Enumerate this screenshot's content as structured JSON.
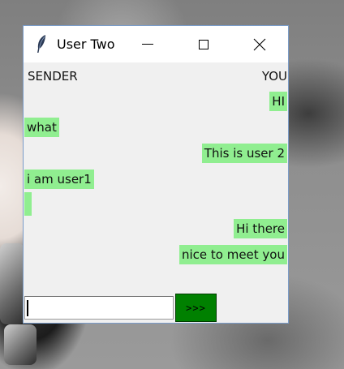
{
  "window": {
    "title": "User Two",
    "icon": "feather-icon",
    "controls": {
      "minimize": "minimize-icon",
      "maximize": "maximize-icon",
      "close": "close-icon"
    }
  },
  "chat": {
    "sender_header": "SENDER",
    "you_header": "YOU",
    "messages": [
      {
        "side": "right",
        "text": "HI"
      },
      {
        "side": "left",
        "text": "what"
      },
      {
        "side": "right",
        "text": "This is user 2"
      },
      {
        "side": "left",
        "text": "i am user1"
      },
      {
        "side": "left",
        "text": ""
      },
      {
        "side": "right",
        "text": "Hi there"
      },
      {
        "side": "right",
        "text": "nice to meet you"
      }
    ],
    "bubble_color": "#90ee90"
  },
  "composer": {
    "input_value": "",
    "send_label": ">>>",
    "send_color": "#008000"
  }
}
